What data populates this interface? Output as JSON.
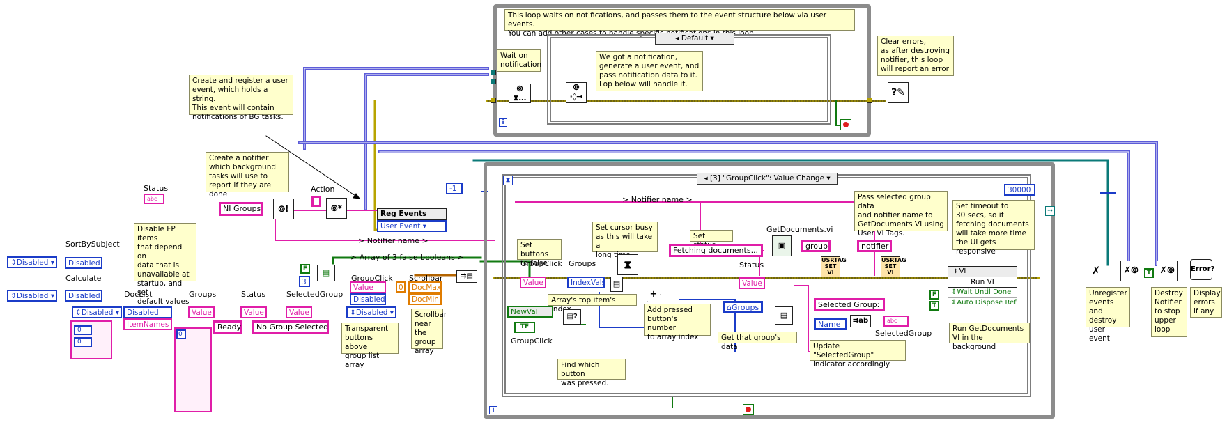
{
  "notes": {
    "notification_loop": "This loop waits on notifications, and passes them to the event structure below via user events.\nYou can add other cases to handle specific notifications in this loop.",
    "wait_on_notification": "Wait on\nnotification",
    "generate_user_event": "We got a notification,\ngenerate a user event, and\npass notification data to it.\nLop below will handle it.",
    "clear_errors": "Clear errors,\nas after destroying\nnotifier, this loop\nwill report an error",
    "create_register_event": "Create and register a user\nevent, which holds a string.\nThis event will contain\nnotifications of BG tasks.",
    "create_notifier": "Create a notifier\nwhich background\ntasks will use to\nreport if they are done",
    "disable_fp_items": "Disable FP items\nthat depend on\ndata that is\nunavailable at\nstartup, and set\ndefault values",
    "transparent_buttons": "Transparent\nbuttons above\ngroup list array",
    "scrollbar_near": "Scrollbar\nnear the\ngroup\narray",
    "set_buttons_false": "Set buttons\nto false",
    "set_cursor_busy": "Set cursor busy\nas this will take a\nlong time",
    "set_status": "Set status",
    "arrays_top_index": "Array's top item's index",
    "add_pressed_button": "Add pressed\nbutton's number\nto array index",
    "get_group_data": "Get that group's data",
    "find_button": "Find which button\nwas pressed.",
    "pass_selected_group": "Pass selected group data\nand notifier name to\nGetDocuments VI using\nUser VI Tags.",
    "set_timeout": "Set timeout to\n30 secs, so if\nfetching documents\nwill take more time\nthe UI gets responsive",
    "run_in_background": "Run GetDocuments\nVI in the background",
    "update_selected_group": "Update \"SelectedGroup\"\nindicator accordingly.",
    "unregister_events": "Unregister\nevents and\ndestroy\nuser event",
    "destroy_notifier": "Destroy\nNotifier\nto stop\nupper\nloop",
    "display_errors": "Display\nerrors\nif any"
  },
  "labels": {
    "status_top": "Status",
    "action": "Action",
    "sort_by_subject": "SortBySubject",
    "calculate": "Calculate",
    "doclist": "DocList",
    "groups": "Groups",
    "status": "Status",
    "selected_group": "SelectedGroup",
    "group_click": "GroupClick",
    "scrollbar": "Scrollbar",
    "array_false": "> Array of 3 false booleans >",
    "notifier_name_left": "> Notifier name >",
    "notifier_name_top": "> Notifier name >",
    "group_click_in": "GroupClick",
    "groups_in": "Groups",
    "status_in": "Status",
    "get_documents_vi": "GetDocuments.vi",
    "selected_group_in": "SelectedGroup",
    "group_click_event": "GroupClick",
    "run_vi": "Run VI",
    "vi": "VI"
  },
  "values": {
    "ni_groups": "NI Groups",
    "notifier_name": "> Notifier name >",
    "disabled": "Disabled",
    "ready": "Ready",
    "no_group_selected": "No Group Selected",
    "const_3": "3",
    "const_0": "0",
    "minus_one": "-1",
    "timeout": "30000",
    "fetching": "Fetching documents...",
    "selected_group_prefix": "Selected Group:",
    "group_tag": "group",
    "notifier_tag": "notifier",
    "value": "Value",
    "item_names": "ItemNames",
    "index_vals": "IndexVals",
    "doc_max": "DocMax",
    "doc_min": "DocMin",
    "new_val": "NewVal",
    "name": "Name",
    "groups_ref": "Groups",
    "user_event": "User Event",
    "reg_events": "Reg Events",
    "wait_until_done": "Wait Until Done",
    "auto_dispose_ref": "Auto Dispose Ref",
    "bool_f": "F",
    "bool_t": "T",
    "tf": "TF",
    "abc": "abc"
  },
  "case_selectors": {
    "notification_case": "Default",
    "event_case": "[3] \"GroupClick\": Value Change"
  },
  "colors": {
    "string_wire": "#e01ea8",
    "numeric_wire": "#1b3cc8",
    "bool_wire": "#117a11",
    "error_wire": "#b8a400",
    "refnum_wire": "#0b7a78",
    "frame": "#8c8c8c",
    "note_bg": "#ffffcc"
  },
  "icons": [
    "wait-notification-icon",
    "generate-event-icon",
    "clear-errors-icon",
    "create-user-event-icon",
    "obtain-notifier-icon",
    "register-events-icon",
    "busy-cursor-icon",
    "set-vi-tag-icon",
    "unregister-icon",
    "destroy-notifier-icon",
    "error-dialog-icon",
    "stop-icon",
    "iteration-icon"
  ]
}
